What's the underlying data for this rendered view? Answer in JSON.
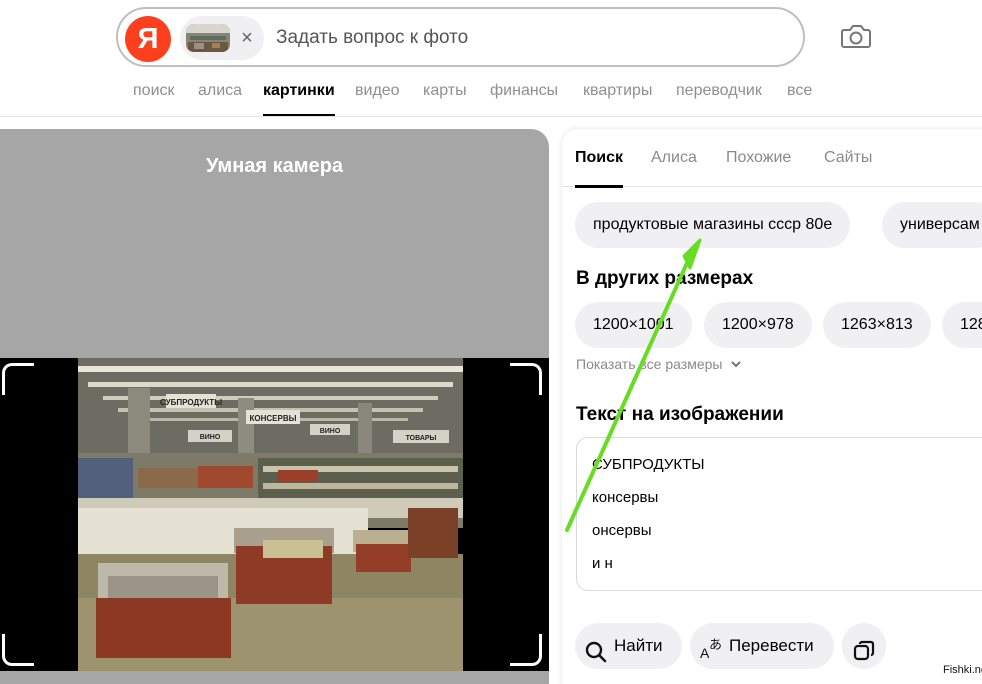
{
  "header": {
    "logo_letter": "Я",
    "search_placeholder": "Задать вопрос к фото",
    "clear_symbol": "×",
    "nav": [
      {
        "label": "поиск"
      },
      {
        "label": "алиса"
      },
      {
        "label": "картинки",
        "active": true
      },
      {
        "label": "видео"
      },
      {
        "label": "карты"
      },
      {
        "label": "финансы"
      },
      {
        "label": "квартиры"
      },
      {
        "label": "переводчик"
      },
      {
        "label": "все"
      }
    ]
  },
  "smart_camera": {
    "title": "Умная камера",
    "photo_signs": {
      "sign1": "СУБПРОДУКТЫ",
      "sign2": "КОНСЕРВЫ",
      "sign3": "ВИНО",
      "sign4": "ТОВАРЫ",
      "sign5": "ВИНО"
    }
  },
  "results": {
    "tabs": [
      {
        "label": "Поиск",
        "active": true
      },
      {
        "label": "Алиса"
      },
      {
        "label": "Похожие"
      },
      {
        "label": "Сайты"
      }
    ],
    "queries": [
      "продуктовые магазины ссср 80е",
      "универсам"
    ],
    "sizes_title": "В других размерах",
    "sizes": [
      "1200×1001",
      "1200×978",
      "1263×813",
      "128"
    ],
    "show_sizes": "Показать все размеры",
    "ocr_title": "Текст на изображении",
    "ocr_lines": [
      "СУБПРОДУКТЫ",
      "консервы",
      "онсервы",
      "и н"
    ],
    "actions": {
      "find": "Найти",
      "translate": "Перевести"
    }
  },
  "colors": {
    "brand_red": "#fc3f1d",
    "annotation_arrow": "#66dd22",
    "panel_gray": "#a6a6a6",
    "chip_bg": "#f0f0f3"
  },
  "watermark": "Fishki.net"
}
